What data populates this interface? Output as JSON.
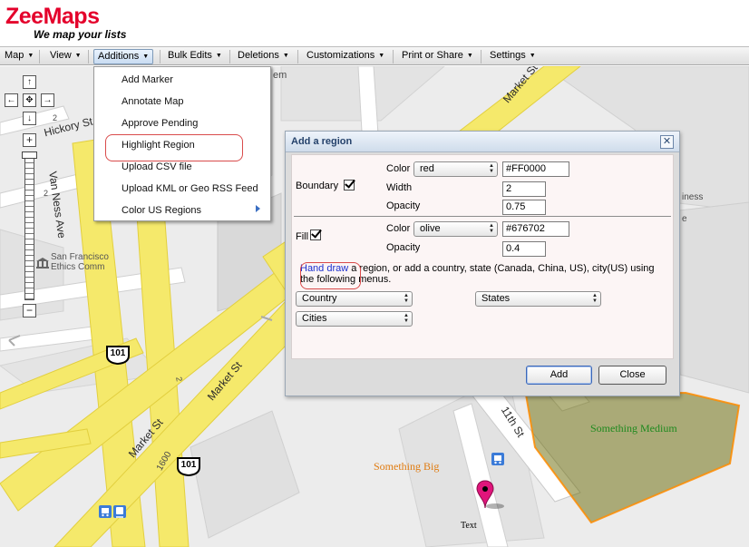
{
  "app": {
    "logo_title": "ZeeMaps",
    "logo_tagline": "We map your lists"
  },
  "menubar": {
    "items": [
      {
        "label": "Map"
      },
      {
        "label": "View"
      },
      {
        "label": "Additions"
      },
      {
        "label": "Bulk Edits"
      },
      {
        "label": "Deletions"
      },
      {
        "label": "Customizations"
      },
      {
        "label": "Print or Share"
      },
      {
        "label": "Settings"
      }
    ],
    "active": "Additions",
    "arrow_glyph": "▼"
  },
  "additions_menu": {
    "items": [
      {
        "label": "Add Marker"
      },
      {
        "label": "Annotate Map"
      },
      {
        "label": "Approve Pending"
      },
      {
        "label": "Highlight Region"
      },
      {
        "label": "Upload CSV file"
      },
      {
        "label": "Upload KML or Geo RSS Feed"
      },
      {
        "label": "Color US Regions"
      }
    ],
    "highlighted": "Highlight Region"
  },
  "map": {
    "street_labels": [
      {
        "text": "Hickory St"
      },
      {
        "text": "Van Ness Ave"
      },
      {
        "text": "Market St"
      },
      {
        "text": "Market St"
      },
      {
        "text": "Market St"
      },
      {
        "text": "11th St"
      }
    ],
    "small_labels": [
      "2",
      "2",
      "2",
      "1600",
      "em",
      "iness",
      "e"
    ],
    "poi": {
      "line1": "San Francisco",
      "line2": "Ethics Comm"
    },
    "highway_shield": "101",
    "annotations": {
      "something_big": "Something Big",
      "something_medium": "Something Medium",
      "marker_text": "Text"
    },
    "colors": {
      "road": "#f5e96b",
      "road_edge": "#e2cf3f",
      "region_fill": "#676702",
      "region_border": "#ff8c00",
      "marker": "#e0157b",
      "something_big_color": "#e07b10",
      "something_medium_color": "#1f8a1f"
    }
  },
  "nav_controls": {
    "up": "↑",
    "down": "↓",
    "left": "←",
    "right": "→",
    "center": "✥",
    "zoom_in": "+",
    "zoom_out": "−"
  },
  "dialog": {
    "title": "Add a region",
    "close_glyph": "✕",
    "boundary": {
      "label": "Boundary",
      "checked": true,
      "color_label": "Color",
      "color_name": "red",
      "color_hex": "#FF0000",
      "width_label": "Width",
      "width_value": "2",
      "opacity_label": "Opacity",
      "opacity_value": "0.75"
    },
    "fill": {
      "label": "Fill",
      "checked": true,
      "color_label": "Color",
      "color_name": "olive",
      "color_hex": "#676702",
      "opacity_label": "Opacity",
      "opacity_value": "0.4"
    },
    "instructions": {
      "link_text": "Hand draw",
      "rest_line1": " a region, or add a country, state (Canada, China, US), city(US) using",
      "rest_line2": "the following menus."
    },
    "selects": {
      "country": "Country",
      "states": "States",
      "cities": "Cities"
    },
    "buttons": {
      "add": "Add",
      "close": "Close"
    }
  }
}
